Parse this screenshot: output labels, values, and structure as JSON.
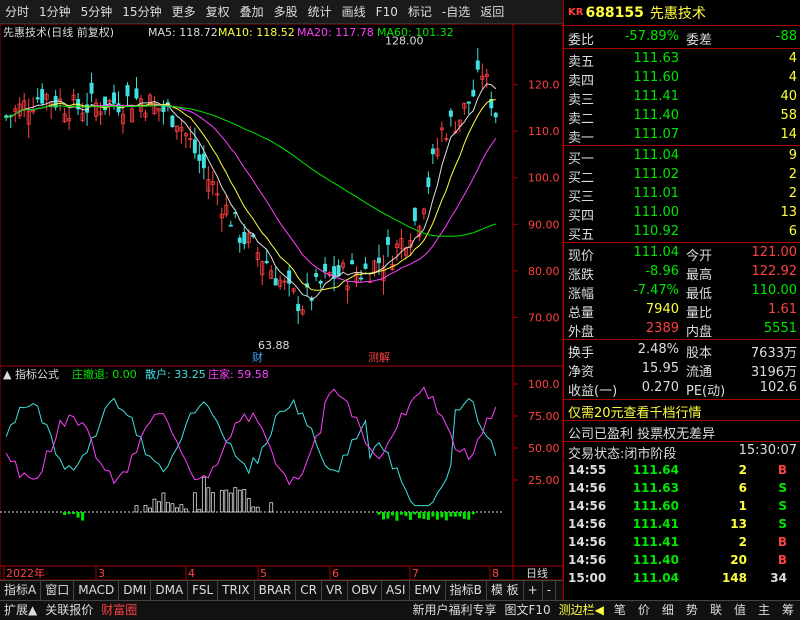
{
  "toolbar": {
    "items": [
      "分时",
      "1分钟",
      "5分钟",
      "15分钟",
      "更多",
      "复权",
      "叠加",
      "多股",
      "统计",
      "画线",
      "F10",
      "标记",
      "-自选",
      "返回"
    ]
  },
  "stock": {
    "logo": "KR",
    "code": "688155",
    "name": "先惠技术"
  },
  "chart_header": {
    "title": "先惠技术(日线 前复权)",
    "ma5": "MA5: 118.72",
    "ma10": "MA10: 118.52",
    "ma20": "MA20: 117.78",
    "ma60": "MA60: 101.32"
  },
  "price_axis": [
    "120.0",
    "110.0",
    "100.0",
    "90.00",
    "80.00",
    "70.00"
  ],
  "annotations": {
    "high": "128.00",
    "low": "63.88",
    "mark1": "财",
    "mark2": "测解"
  },
  "indicator": {
    "name": "指标公式",
    "l1": "庄撤退: 0.00",
    "l2": "散户: 33.25",
    "l3": "庄家: 59.58",
    "axis": [
      "100.0",
      "75.00",
      "50.00",
      "25.00"
    ]
  },
  "x_axis": {
    "labels": [
      "2022年",
      "3",
      "4",
      "5",
      "6",
      "7",
      "8"
    ],
    "period": "日线"
  },
  "quote": {
    "weibi_label": "委比",
    "weibi": "-57.89%",
    "weicha_label": "委差",
    "weicha": "-88",
    "asks": [
      {
        "label": "卖五",
        "price": "111.63",
        "vol": "4"
      },
      {
        "label": "卖四",
        "price": "111.60",
        "vol": "4"
      },
      {
        "label": "卖三",
        "price": "111.41",
        "vol": "40"
      },
      {
        "label": "卖二",
        "price": "111.40",
        "vol": "58"
      },
      {
        "label": "卖一",
        "price": "111.07",
        "vol": "14"
      }
    ],
    "bids": [
      {
        "label": "买一",
        "price": "111.04",
        "vol": "9"
      },
      {
        "label": "买二",
        "price": "111.02",
        "vol": "2"
      },
      {
        "label": "买三",
        "price": "111.01",
        "vol": "2"
      },
      {
        "label": "买四",
        "price": "111.00",
        "vol": "13"
      },
      {
        "label": "买五",
        "price": "110.92",
        "vol": "6"
      }
    ],
    "stats": [
      {
        "l1": "现价",
        "v1": "111.04",
        "c1": "g",
        "l2": "今开",
        "v2": "121.00",
        "c2": "r"
      },
      {
        "l1": "涨跌",
        "v1": "-8.96",
        "c1": "g",
        "l2": "最高",
        "v2": "122.92",
        "c2": "r"
      },
      {
        "l1": "涨幅",
        "v1": "-7.47%",
        "c1": "g",
        "l2": "最低",
        "v2": "110.00",
        "c2": "g"
      },
      {
        "l1": "总量",
        "v1": "7940",
        "c1": "y",
        "l2": "量比",
        "v2": "1.61",
        "c2": "r"
      },
      {
        "l1": "外盘",
        "v1": "2389",
        "c1": "r",
        "l2": "内盘",
        "v2": "5551",
        "c2": "g"
      }
    ],
    "stats2": [
      {
        "l1": "换手",
        "v1": "2.48%",
        "l2": "股本",
        "v2": "7633万"
      },
      {
        "l1": "净资",
        "v1": "15.95",
        "l2": "流通",
        "v2": "3196万"
      },
      {
        "l1": "收益(一)",
        "v1": "0.270",
        "l2": "PE(动)",
        "v2": "102.6"
      }
    ],
    "promo": "仅需20元查看千档行情",
    "notice": "公司已盈利 投票权无差异",
    "trade_status": "交易状态:闭市阶段",
    "trade_time": "15:30:07"
  },
  "ticks": [
    {
      "t": "14:55",
      "p": "111.64",
      "v": "2",
      "s": "B"
    },
    {
      "t": "14:56",
      "p": "111.63",
      "v": "6",
      "s": "S"
    },
    {
      "t": "14:56",
      "p": "111.60",
      "v": "1",
      "s": "S"
    },
    {
      "t": "14:56",
      "p": "111.41",
      "v": "13",
      "s": "S"
    },
    {
      "t": "14:56",
      "p": "111.41",
      "v": "2",
      "s": "B"
    },
    {
      "t": "14:56",
      "p": "111.40",
      "v": "20",
      "s": "B"
    },
    {
      "t": "15:00",
      "p": "111.04",
      "v": "148",
      "s": "34"
    }
  ],
  "bottom_tabs": [
    "指标A",
    "窗口",
    "MACD",
    "DMI",
    "DMA",
    "FSL",
    "TRIX",
    "BRAR",
    "CR",
    "VR",
    "OBV",
    "ASI",
    "EMV",
    "指标B",
    "模 板",
    "+",
    "-"
  ],
  "status_bar": {
    "left": [
      "扩展▲",
      "关联报价",
      "财富圈"
    ],
    "mid": [
      "新用户福利专享",
      "图文F10",
      "测边栏◀"
    ],
    "right": [
      "笔",
      "价",
      "细",
      "势",
      "联",
      "值",
      "主",
      "筹"
    ]
  },
  "colors": {
    "up": "#ff4040",
    "down": "#00e600",
    "ma5": "#ffffff",
    "ma10": "#ffff40",
    "ma20": "#ff40ff",
    "ma60": "#00e600"
  }
}
